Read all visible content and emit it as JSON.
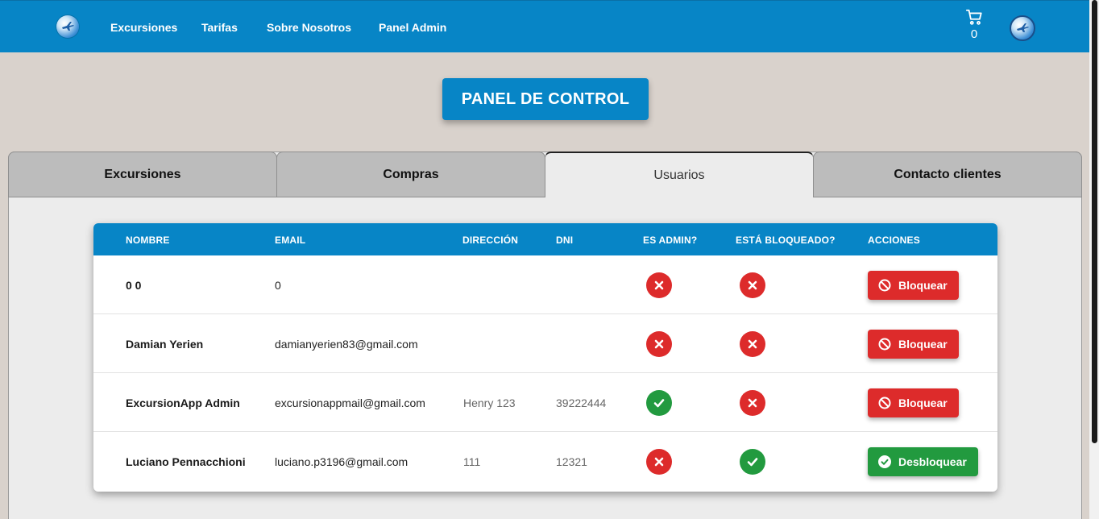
{
  "nav": {
    "links": [
      "Excursiones",
      "Tarifas",
      "Sobre Nosotros",
      "Panel Admin"
    ],
    "cart_count": "0"
  },
  "panel": {
    "title": "PANEL DE CONTROL"
  },
  "tabs": [
    {
      "label": "Excursiones",
      "active": false
    },
    {
      "label": "Compras",
      "active": false
    },
    {
      "label": "Usuarios",
      "active": true
    },
    {
      "label": "Contacto clientes",
      "active": false
    }
  ],
  "table": {
    "headers": [
      "NOMBRE",
      "EMAIL",
      "DIRECCIÓN",
      "DNI",
      "ES ADMIN?",
      "ESTÁ BLOQUEADO?",
      "ACCIONES"
    ],
    "rows": [
      {
        "nombre": "0 0",
        "email": "0",
        "direccion": "",
        "dni": "",
        "admin": false,
        "bloqueado": false,
        "accion": "Bloquear"
      },
      {
        "nombre": "Damian Yerien",
        "email": "damianyerien83@gmail.com",
        "direccion": "",
        "dni": "",
        "admin": false,
        "bloqueado": false,
        "accion": "Bloquear"
      },
      {
        "nombre": "ExcursionApp Admin",
        "email": "excursionappmail@gmail.com",
        "direccion": "Henry 123",
        "dni": "39222444",
        "admin": true,
        "bloqueado": false,
        "accion": "Bloquear"
      },
      {
        "nombre": "Luciano Pennacchioni",
        "email": "luciano.p3196@gmail.com",
        "direccion": "111",
        "dni": "12321",
        "admin": false,
        "bloqueado": true,
        "accion": "Desbloquear"
      }
    ]
  },
  "colors": {
    "primary": "#0785c6",
    "danger": "#dd2b2b",
    "success": "#229a3f",
    "page_bg": "#d9d2cc"
  }
}
